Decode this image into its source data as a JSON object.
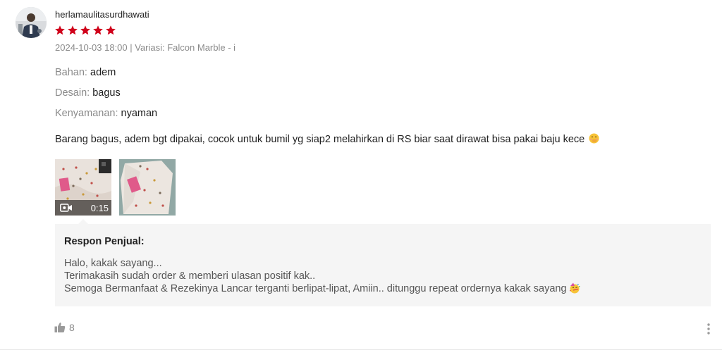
{
  "review": {
    "username": "herlamaulitasurdhawati",
    "rating": 5,
    "rating_max": 5,
    "meta": "2024-10-03 18:00 | Variasi: Falcon Marble - i",
    "attributes": [
      {
        "label": "Bahan:",
        "value": "adem"
      },
      {
        "label": "Desain:",
        "value": "bagus"
      },
      {
        "label": "Kenyamanan:",
        "value": "nyaman"
      }
    ],
    "comment": "Barang bagus, adem bgt dipakai, cocok untuk bumil yg siap2 melahirkan di RS biar saat dirawat bisa pakai baju kece",
    "media": [
      {
        "type": "video",
        "duration": "0:15"
      },
      {
        "type": "image"
      }
    ],
    "seller_response": {
      "title": "Respon Penjual:",
      "lines": [
        "Halo, kakak sayang...",
        "Terimakasih sudah order & memberi ulasan positif kak..",
        "Semoga Bermanfaat & Rezekinya Lancar terganti berlipat-lipat, Amiin..  ditunggu repeat ordernya kakak sayang"
      ]
    },
    "likes": "8"
  },
  "colors": {
    "star": "#d0011b",
    "muted_text": "#8a8a8a",
    "response_bg": "#f5f5f5",
    "divider": "#e8e8e8"
  },
  "icons": {
    "rating": "star-icon",
    "video": "video-camera-icon",
    "like": "thumbs-up-icon",
    "more": "more-vertical-icon",
    "comment_emoji": "face-with-hand-over-mouth-icon",
    "response_emoji": "partying-face-icon"
  }
}
